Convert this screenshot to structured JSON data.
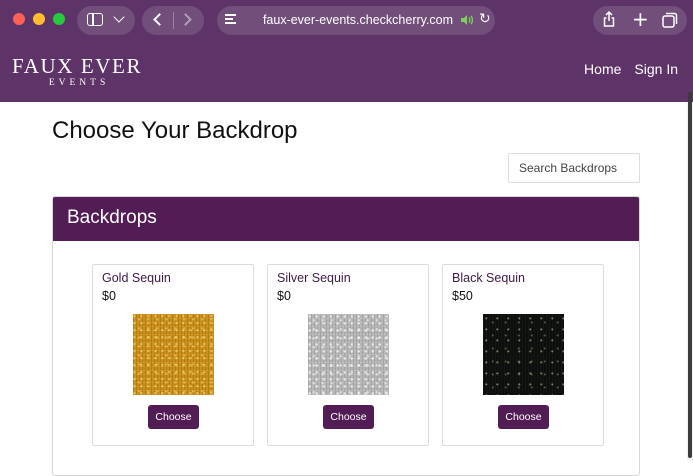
{
  "browser": {
    "url": "faux-ever-events.checkcherry.com",
    "icons": {
      "sidebar": "sidebar-icon",
      "tab_menu": "chevron-down-icon",
      "back": "chevron-left-icon",
      "forward": "chevron-right-icon",
      "page_settings": "page-settings-icon",
      "audio": "speaker-icon",
      "reload": "reload-icon",
      "share": "share-icon",
      "new_tab": "plus-icon",
      "tab_overview": "tabs-icon"
    }
  },
  "header": {
    "logo_main": "FAUX EVER",
    "logo_sub": "EVENTS",
    "nav": [
      {
        "label": "Home"
      },
      {
        "label": "Sign In"
      }
    ]
  },
  "page": {
    "title": "Choose Your Backdrop",
    "search_placeholder": "Search Backdrops"
  },
  "panel": {
    "heading": "Backdrops",
    "items": [
      {
        "name": "Gold Sequin",
        "price": "$0",
        "button": "Choose",
        "swatch_color": "#c98d18"
      },
      {
        "name": "Silver Sequin",
        "price": "$0",
        "button": "Choose",
        "swatch_color": "#b5b5b5"
      },
      {
        "name": "Black Sequin",
        "price": "$50",
        "button": "Choose",
        "swatch_color": "#0d0f0d"
      }
    ]
  },
  "colors": {
    "brand": "#5e3468",
    "panel_heading": "#521d55",
    "button": "#521d55"
  }
}
